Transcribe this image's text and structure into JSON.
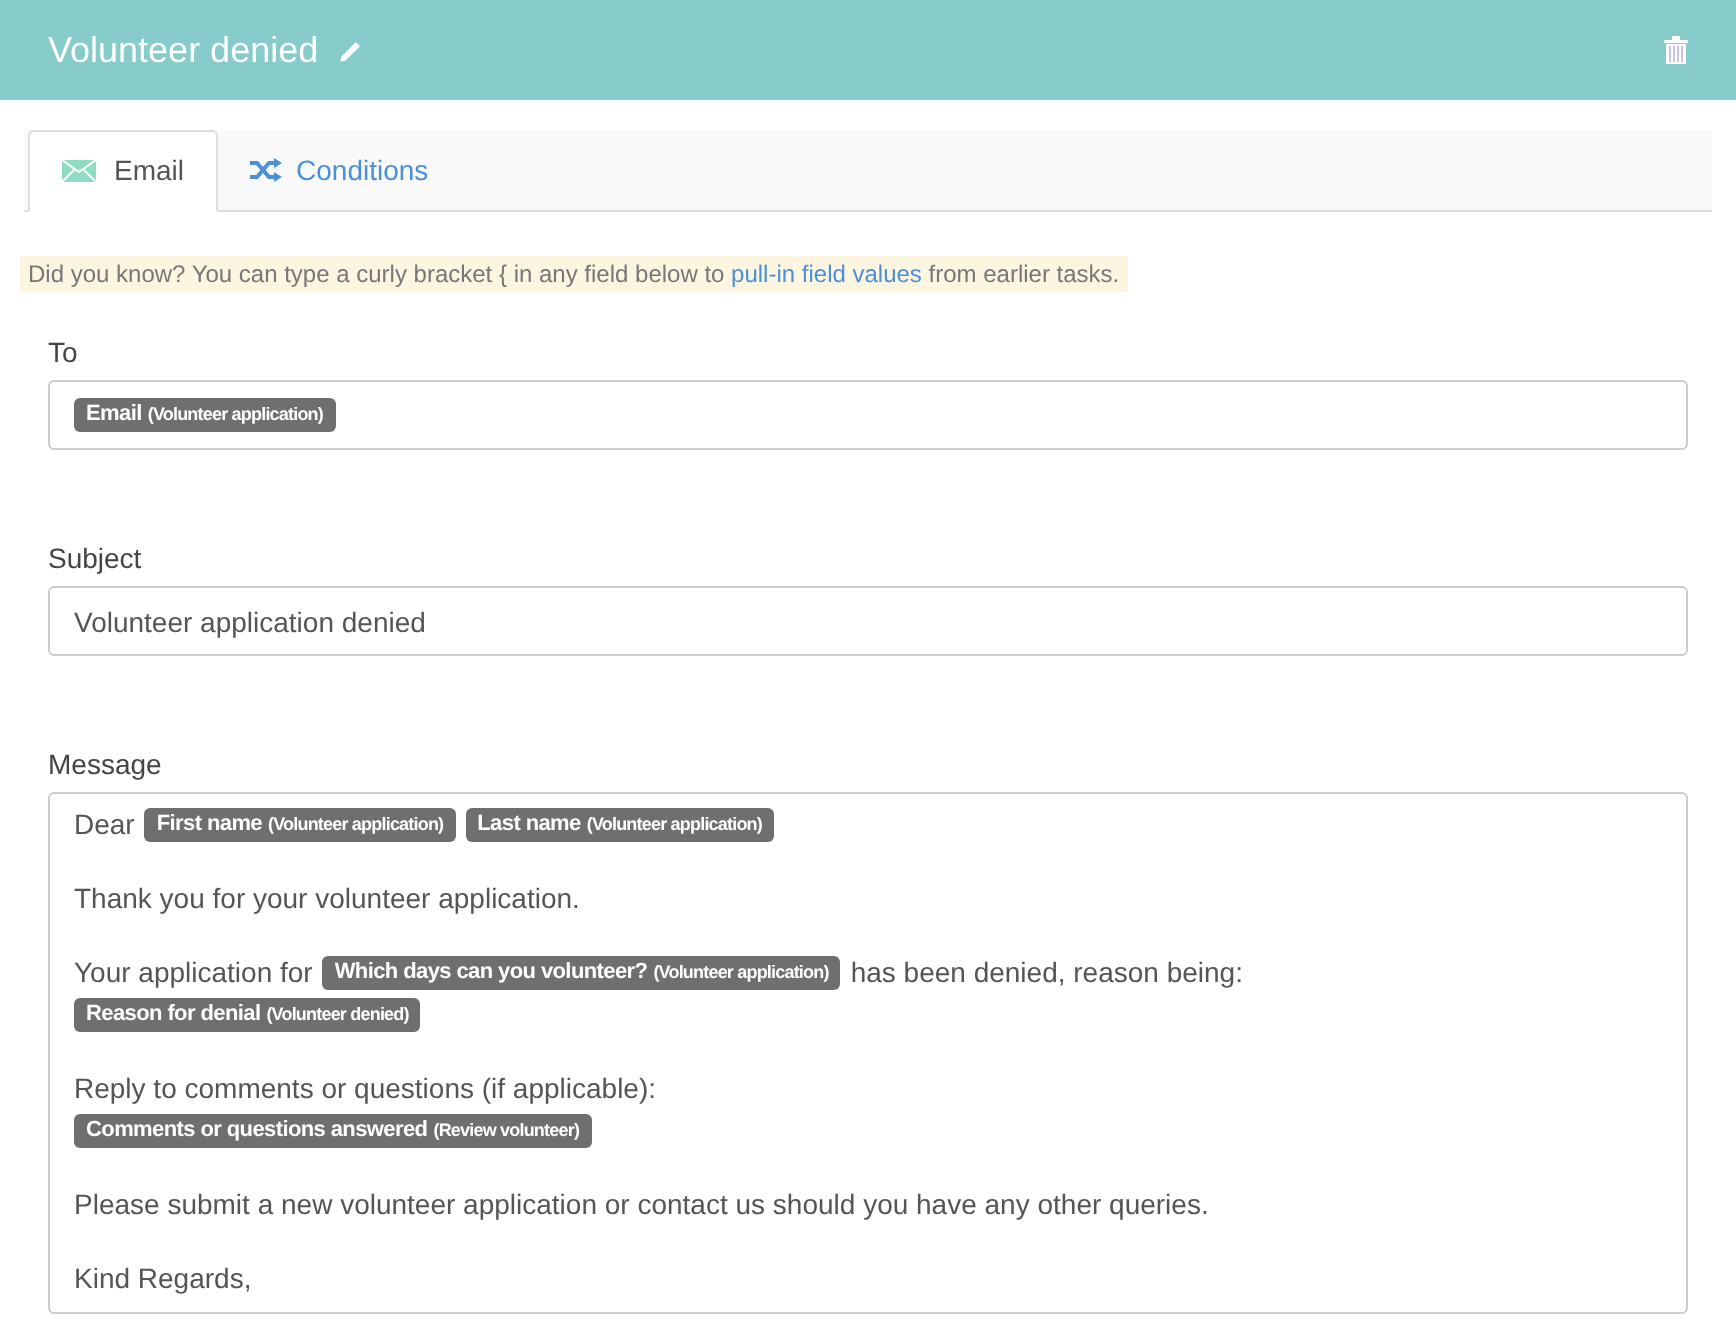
{
  "header": {
    "title": "Volunteer denied"
  },
  "tabs": [
    {
      "label": "Email",
      "selected": true,
      "kind": "email"
    },
    {
      "label": "Conditions",
      "selected": false,
      "kind": "conditions"
    }
  ],
  "hint": {
    "before": "Did you know? You can type a curly bracket { in any field below to",
    "link": "pull-in field values",
    "after": "from earlier tasks."
  },
  "to": {
    "label": "To",
    "tokens": [
      {
        "field": "Email",
        "source": "(Volunteer application)"
      }
    ]
  },
  "subject": {
    "label": "Subject",
    "value": "Volunteer application denied"
  },
  "message": {
    "label": "Message",
    "paragraphs": [
      [
        [
          {
            "kind": "text",
            "text": "Dear"
          },
          {
            "kind": "token",
            "field": "First name",
            "source": "(Volunteer application)"
          },
          {
            "kind": "token",
            "field": "Last name",
            "source": "(Volunteer application)"
          }
        ]
      ],
      [
        [
          {
            "kind": "text",
            "text": "Thank you for your volunteer application."
          }
        ]
      ],
      [
        [
          {
            "kind": "text",
            "text": "Your application for"
          },
          {
            "kind": "token",
            "field": "Which days can you volunteer?",
            "source": "(Volunteer application)"
          },
          {
            "kind": "text",
            "text": "has been denied, reason being:"
          }
        ],
        [
          {
            "kind": "token",
            "field": "Reason for denial",
            "source": "(Volunteer denied)"
          }
        ]
      ],
      [
        [
          {
            "kind": "text",
            "text": "Reply to comments or questions (if applicable):"
          }
        ],
        [
          {
            "kind": "token",
            "field": "Comments or questions answered",
            "source": "(Review volunteer)"
          }
        ]
      ],
      [
        [
          {
            "kind": "text",
            "text": "Please submit a new volunteer application or contact us should you have any other queries."
          }
        ]
      ],
      [
        [
          {
            "kind": "text",
            "text": "Kind Regards,"
          }
        ]
      ]
    ]
  }
}
